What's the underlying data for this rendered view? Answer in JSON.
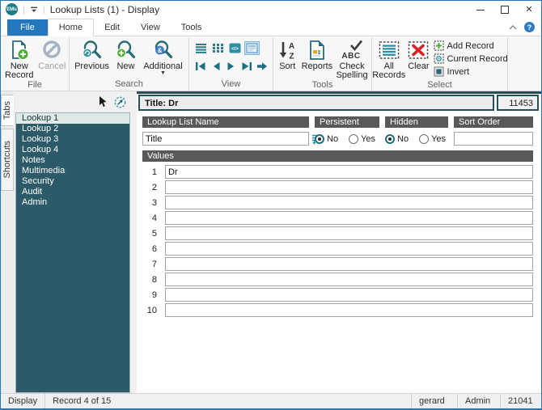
{
  "titlebar": {
    "app_initials": "EMu",
    "title": "Lookup Lists (1) - Display"
  },
  "icons": {
    "close": "✕",
    "help": "?",
    "code_view": "</>",
    "sort_a": "A",
    "sort_z": "Z",
    "spell_abc": "ABC",
    "ampersand": "&"
  },
  "ribbon": {
    "tabs": {
      "file": "File",
      "home": "Home",
      "edit": "Edit",
      "view": "View",
      "tools": "Tools"
    },
    "active_tab": "Home",
    "groups": {
      "file": {
        "label": "File",
        "new_record": "New Record",
        "cancel": "Cancel"
      },
      "search": {
        "label": "Search",
        "previous": "Previous",
        "new": "New",
        "additional": "Additional"
      },
      "view": {
        "label": "View"
      },
      "tools": {
        "label": "Tools",
        "sort": "Sort",
        "reports": "Reports",
        "check_spelling": "Check Spelling"
      },
      "select": {
        "label": "Select",
        "all_records": "All Records",
        "clear": "Clear",
        "add_record": "Add Record",
        "current_record": "Current Record",
        "invert": "Invert"
      }
    }
  },
  "sidebar": {
    "vertical_tabs": {
      "tabs": "Tabs",
      "shortcuts": "Shortcuts"
    },
    "active_vertical_tab": "Tabs",
    "items": [
      "Lookup 1",
      "Lookup 2",
      "Lookup 3",
      "Lookup 4",
      "Notes",
      "Multimedia",
      "Security",
      "Audit",
      "Admin"
    ],
    "selected_item": "Lookup 1"
  },
  "record": {
    "header_title": "Title: Dr",
    "record_number": "11453",
    "lookup_list_name": {
      "label": "Lookup List Name",
      "value": "Title"
    },
    "persistent": {
      "label": "Persistent",
      "option_no": "No",
      "option_yes": "Yes",
      "selected": "No"
    },
    "hidden": {
      "label": "Hidden",
      "option_no": "No",
      "option_yes": "Yes",
      "selected": "No"
    },
    "sort_order": {
      "label": "Sort Order",
      "value": ""
    },
    "values": {
      "label": "Values",
      "rows": [
        {
          "num": "1",
          "value": "Dr"
        },
        {
          "num": "2",
          "value": ""
        },
        {
          "num": "3",
          "value": ""
        },
        {
          "num": "4",
          "value": ""
        },
        {
          "num": "5",
          "value": ""
        },
        {
          "num": "6",
          "value": ""
        },
        {
          "num": "7",
          "value": ""
        },
        {
          "num": "8",
          "value": ""
        },
        {
          "num": "9",
          "value": ""
        },
        {
          "num": "10",
          "value": ""
        }
      ]
    }
  },
  "statusbar": {
    "mode": "Display",
    "record_position": "Record 4 of 15",
    "user": "gerard",
    "group": "Admin",
    "number": "21041"
  },
  "colors": {
    "accent_blue": "#2776bd",
    "sidebar_teal": "#2d5a68",
    "frame_teal": "#24505c",
    "icon_teal": "#2b7a8a",
    "label_gray": "#595959",
    "plus_green": "#4cae2f",
    "clear_red": "#d8232a"
  }
}
